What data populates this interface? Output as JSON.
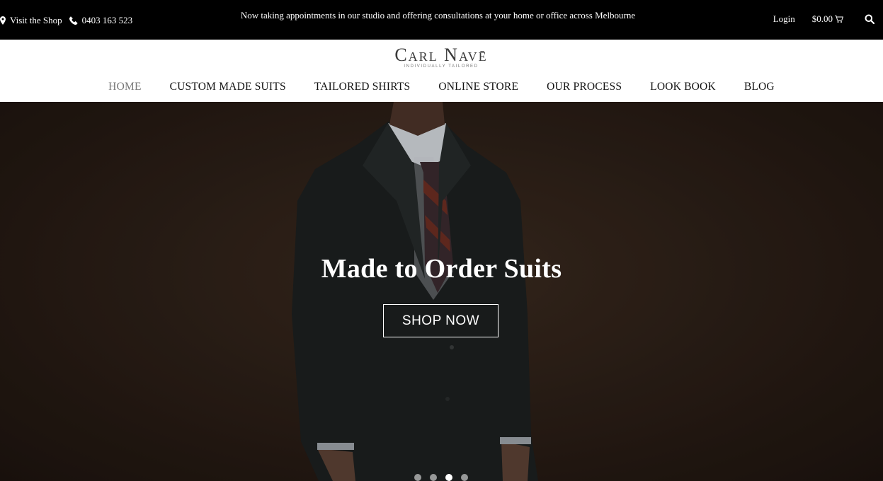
{
  "topbar": {
    "visit_shop": "Visit the Shop",
    "phone": "0403 163 523",
    "announcement": "Now taking appointments in our studio and offering consultations at your home or office across Melbourne",
    "login": "Login",
    "cart_total": "$0.00"
  },
  "brand": {
    "name": "Carl Navē",
    "tagline": "INDIVIDUALLY TAILORED"
  },
  "nav": {
    "items": [
      {
        "label": "HOME",
        "active": true
      },
      {
        "label": "CUSTOM MADE SUITS"
      },
      {
        "label": "TAILORED SHIRTS"
      },
      {
        "label": "ONLINE STORE"
      },
      {
        "label": "OUR PROCESS"
      },
      {
        "label": "LOOK BOOK"
      },
      {
        "label": "BLOG"
      }
    ]
  },
  "hero": {
    "headline": "Made to Order Suits",
    "cta": "SHOP NOW",
    "slides_total": 4,
    "active_slide": 3
  },
  "colors": {
    "topbar_bg": "#000000",
    "header_bg": "#ffffff",
    "hero_bg": "#2c1f17",
    "nav_active": "#777777"
  }
}
